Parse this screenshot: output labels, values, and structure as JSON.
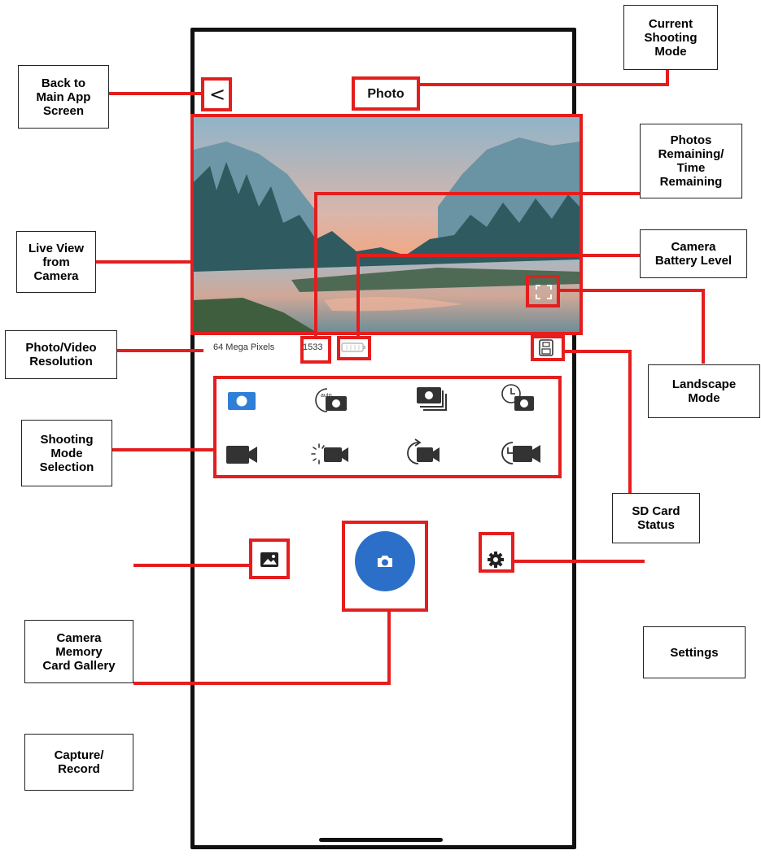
{
  "screen": {
    "title": "Photo",
    "back_glyph": "<",
    "resolution": "64 Mega Pixels",
    "remaining": "1533"
  },
  "callouts": {
    "back": "Back to\nMain App\nScreen",
    "current_mode": "Current\nShooting\nMode",
    "photos_remaining": "Photos\nRemaining/\nTime\nRemaining",
    "live_view": "Live View\nfrom\nCamera",
    "battery": "Camera\nBattery Level",
    "resolution": "Photo/Video\nResolution",
    "landscape": "Landscape\nMode",
    "shooting_mode": "Shooting\nMode\nSelection",
    "sd_card": "SD Card\nStatus",
    "gallery": "Camera\nMemory\nCard Gallery",
    "settings": "Settings",
    "capture": "Capture/\nRecord"
  },
  "modes": {
    "photo_row": [
      "single-photo-icon",
      "auto-timer-photo-icon",
      "burst-photo-icon",
      "timelapse-photo-icon"
    ],
    "video_row": [
      "video-icon",
      "slow-motion-video-icon",
      "loop-video-icon",
      "timelapse-video-icon"
    ],
    "selected": "single-photo-icon"
  },
  "colors": {
    "annotation_red": "#e41e1e",
    "accent_blue": "#2f7fd6",
    "capture_blue": "#2b6fc9"
  }
}
